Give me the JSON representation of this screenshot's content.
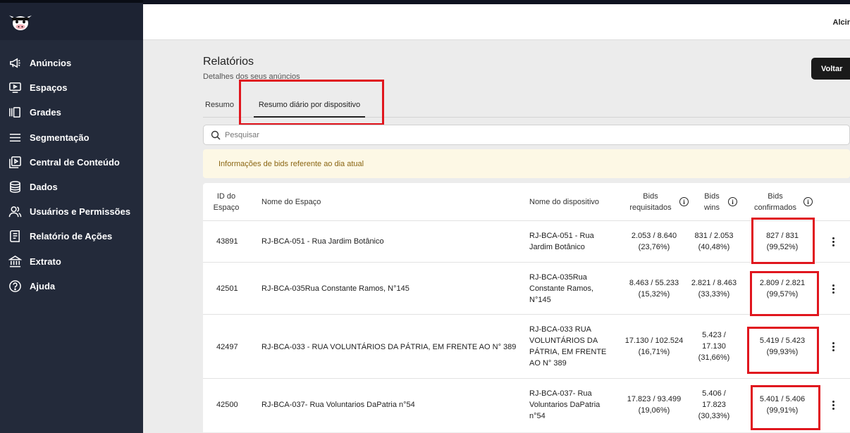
{
  "sidebar": {
    "items": [
      {
        "label": "Anúncios",
        "icon": "megaphone-icon"
      },
      {
        "label": "Espaços",
        "icon": "screen-icon"
      },
      {
        "label": "Grades",
        "icon": "grid-icon"
      },
      {
        "label": "Segmentação",
        "icon": "menu-lines-icon"
      },
      {
        "label": "Central de Conteúdo",
        "icon": "media-library-icon"
      },
      {
        "label": "Dados",
        "icon": "database-icon"
      },
      {
        "label": "Usuários e Permissões",
        "icon": "users-icon"
      },
      {
        "label": "Relatório de Ações",
        "icon": "report-icon"
      },
      {
        "label": "Extrato",
        "icon": "bank-icon"
      },
      {
        "label": "Ajuda",
        "icon": "help-icon"
      }
    ]
  },
  "header": {
    "user_name": "Alcir"
  },
  "page": {
    "title": "Relatórios",
    "subtitle": "Detalhes dos seus anúncios",
    "back_label": "Voltar"
  },
  "tabs": [
    {
      "label": "Resumo"
    },
    {
      "label": "Resumo diário por dispositivo"
    }
  ],
  "search": {
    "placeholder": "Pesquisar",
    "value": ""
  },
  "info_banner": "Informações de bids referente ao dia atual",
  "table": {
    "headers": {
      "id": [
        "ID do",
        "Espaço"
      ],
      "space_name": "Nome do Espaço",
      "device_name": "Nome do dispositivo",
      "requested": [
        "Bids",
        "requisitados"
      ],
      "wins": [
        "Bids",
        "wins"
      ],
      "confirmed": [
        "Bids",
        "confirmados"
      ]
    },
    "rows": [
      {
        "id": "43891",
        "space": "RJ-BCA-051 - Rua Jardim Botânico",
        "device": [
          "RJ-BCA-051 - Rua",
          "Jardim Botânico"
        ],
        "requested": [
          "2.053 / 8.640",
          "(23,76%)"
        ],
        "wins": [
          "831 / 2.053",
          "(40,48%)"
        ],
        "confirmed": [
          "827 / 831",
          "(99,52%)"
        ]
      },
      {
        "id": "42501",
        "space": "RJ-BCA-035Rua Constante Ramos, N°145",
        "device": [
          "RJ-BCA-035Rua",
          "Constante Ramos,",
          "N°145"
        ],
        "requested": [
          "8.463 / 55.233",
          "(15,32%)"
        ],
        "wins": [
          "2.821 / 8.463",
          "(33,33%)"
        ],
        "confirmed": [
          "2.809 / 2.821",
          "(99,57%)"
        ]
      },
      {
        "id": "42497",
        "space": "RJ-BCA-033 - RUA VOLUNTÁRIOS DA PÁTRIA, EM FRENTE AO N° 389",
        "device": [
          "RJ-BCA-033 RUA",
          "VOLUNTÁRIOS DA",
          "PÁTRIA, EM FRENTE",
          "AO N° 389"
        ],
        "requested": [
          "17.130 / 102.524",
          "(16,71%)"
        ],
        "wins": [
          "5.423 /",
          "17.130",
          "(31,66%)"
        ],
        "confirmed": [
          "5.419 / 5.423",
          "(99,93%)"
        ]
      },
      {
        "id": "42500",
        "space": "RJ-BCA-037- Rua Voluntarios DaPatria n°54",
        "device": [
          "RJ-BCA-037- Rua",
          "Voluntarios DaPatria",
          "n°54"
        ],
        "requested": [
          "17.823 / 93.499",
          "(19,06%)"
        ],
        "wins": [
          "5.406 /",
          "17.823",
          "(30,33%)"
        ],
        "confirmed": [
          "5.401 / 5.406",
          "(99,91%)"
        ]
      }
    ]
  },
  "colors": {
    "sidebar": "#232a3a",
    "highlight": "#e0161e",
    "info_bg": "#fdf8e5",
    "info_text": "#8a6512"
  }
}
